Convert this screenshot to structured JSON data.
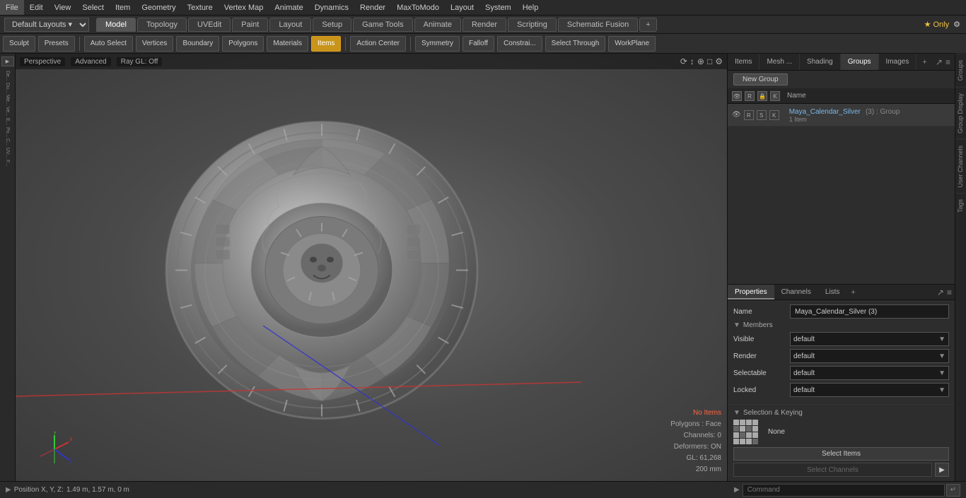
{
  "menu": {
    "items": [
      "File",
      "Edit",
      "View",
      "Select",
      "Item",
      "Geometry",
      "Texture",
      "Vertex Map",
      "Animate",
      "Dynamics",
      "Render",
      "MaxToModo",
      "Layout",
      "System",
      "Help"
    ]
  },
  "layout_bar": {
    "dropdown": "Default Layouts ▾",
    "tabs": [
      "Model",
      "Topology",
      "UVEdit",
      "Paint",
      "Layout",
      "Setup",
      "Game Tools",
      "Animate",
      "Render",
      "Scripting",
      "Schematic Fusion"
    ],
    "active_tab": "Model",
    "add_icon": "+",
    "star_only": "★ Only"
  },
  "tools_bar": {
    "sculpt": "Sculpt",
    "presets": "Presets",
    "auto_select": "Auto Select",
    "vertices": "Vertices",
    "boundary": "Boundary",
    "polygons": "Polygons",
    "materials": "Materials",
    "items": "Items",
    "action_center": "Action Center",
    "symmetry": "Symmetry",
    "falloff": "Falloff",
    "constrain": "Constrai...",
    "select_through": "Select Through",
    "workplane": "WorkPlane"
  },
  "viewport": {
    "type": "Perspective",
    "quality": "Advanced",
    "render": "Ray GL: Off"
  },
  "stats": {
    "no_items": "No Items",
    "polygons": "Polygons : Face",
    "channels": "Channels: 0",
    "deformers": "Deformers: ON",
    "gl": "GL: 61,268",
    "size": "200 mm"
  },
  "coord_bar": {
    "label": "Position X, Y, Z:",
    "value": "1.49 m, 1.57 m, 0 m"
  },
  "right_panel": {
    "tabs": [
      "Items",
      "Mesh ...",
      "Shading",
      "Groups",
      "Images"
    ],
    "active_tab": "Groups",
    "add_icon": "+",
    "new_group": "New Group",
    "name_col": "Name",
    "group_name": "Maya_Calendar_Silver",
    "group_suffix": "(3) : Group",
    "group_count": "1 Item"
  },
  "properties": {
    "tabs": [
      "Properties",
      "Channels",
      "Lists"
    ],
    "active_tab": "Properties",
    "name_label": "Name",
    "name_value": "Maya_Calendar_Silver (3)",
    "members_label": "Members",
    "visible_label": "Visible",
    "visible_value": "default",
    "render_label": "Render",
    "render_value": "default",
    "selectable_label": "Selectable",
    "selectable_value": "default",
    "locked_label": "Locked",
    "locked_value": "default",
    "sel_keying_label": "Selection & Keying",
    "none_label": "None",
    "select_items": "Select Items",
    "select_channels": "Select Channels"
  },
  "vtabs": [
    "Groups",
    "Group Display",
    "User Channels",
    "Tags"
  ],
  "command_bar": {
    "label": "Command",
    "placeholder": "Command"
  }
}
